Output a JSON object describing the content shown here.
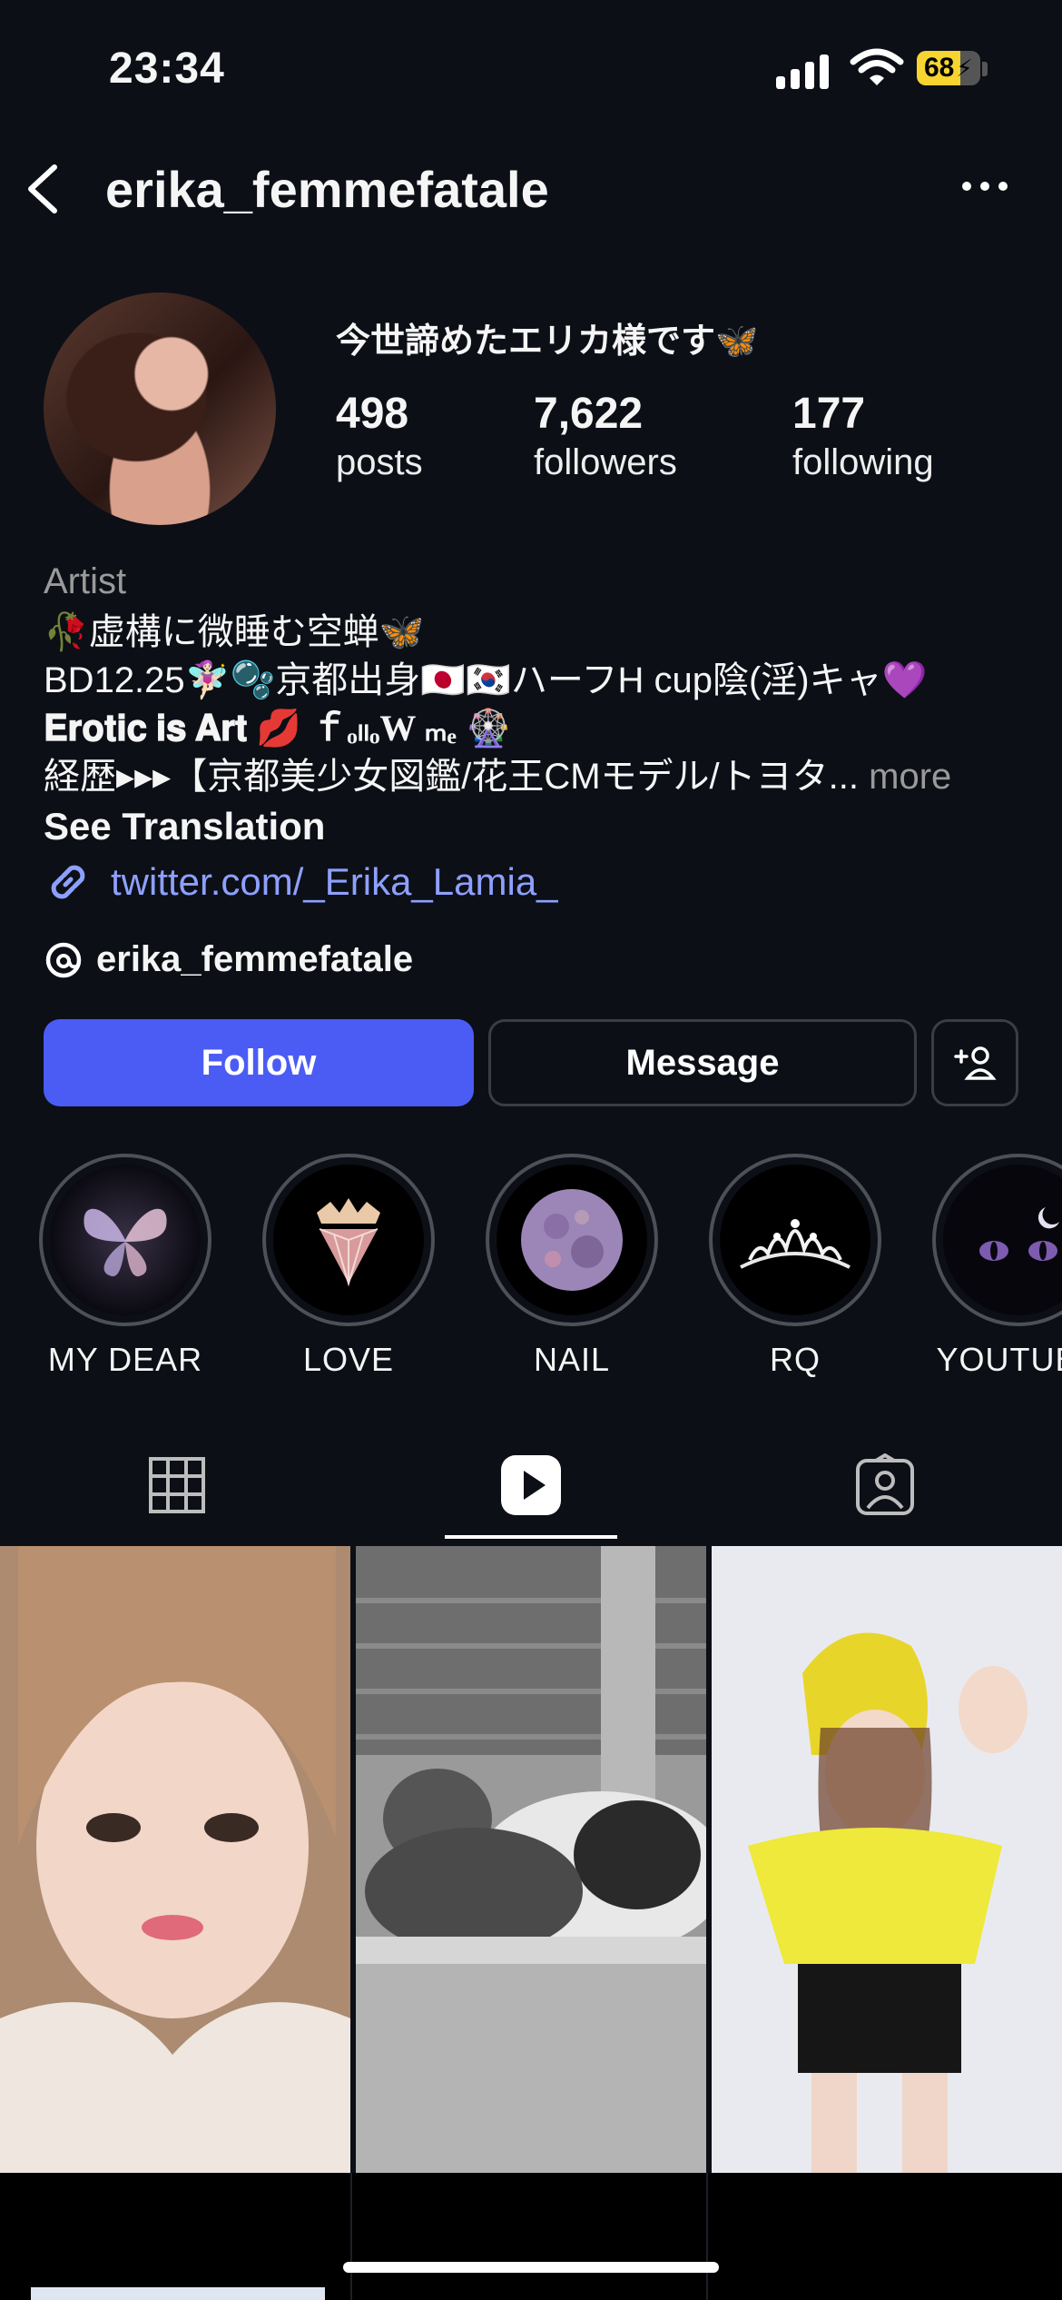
{
  "status_bar": {
    "time": "23:34",
    "battery": "68",
    "battery_percent": 68,
    "icons": [
      "cellular-signal-icon",
      "wifi-icon",
      "battery-charging-icon"
    ]
  },
  "header": {
    "username": "erika_femmefatale",
    "icons": [
      "back-chevron-icon",
      "more-options-icon"
    ]
  },
  "profile": {
    "display_name": "今世諦めたエリカ様です🦋",
    "stats": [
      {
        "value": "498",
        "label": "posts"
      },
      {
        "value": "7,622",
        "label": "followers"
      },
      {
        "value": "177",
        "label": "following"
      }
    ],
    "category": "Artist",
    "bio_lines": [
      "🥀虚構に微睡む空蝉🦋",
      "BD12.25🧚🏻‍♀️🫧京都出身🇯🇵🇰🇷ハーフH cup陰(淫)キャ💜",
      "𝐄𝐫𝐨𝐭𝐢𝐜 𝐢𝐬 𝐀𝐫𝐭 💋 ｆₒₗₗₒW ₘₑ 🎡",
      "経歴▸▸▸【京都美少女図鑑/花王CMモデル/トヨタ..."
    ],
    "bio_more": "more",
    "see_translation": "See Translation",
    "link": "twitter.com/_Erika_Lamia_",
    "threads_handle": "erika_femmefatale"
  },
  "actions": {
    "follow": "Follow",
    "message": "Message"
  },
  "highlights": [
    {
      "label": "MY DEAR",
      "icon": "butterfly-icon"
    },
    {
      "label": "LOVE",
      "icon": "diamond-crown-icon"
    },
    {
      "label": "NAIL",
      "icon": "moon-icon"
    },
    {
      "label": "RQ",
      "icon": "tiara-icon"
    },
    {
      "label": "YOUTUBE",
      "icon": "cat-eyes-icon"
    }
  ],
  "tabs": [
    {
      "name": "posts-grid",
      "icon": "grid-icon",
      "active": false
    },
    {
      "name": "reels",
      "icon": "reels-play-icon",
      "active": true
    },
    {
      "name": "tagged",
      "icon": "tagged-person-icon",
      "active": false
    }
  ],
  "colors": {
    "background": "#0c0f16",
    "accent": "#4b5cf5",
    "link": "#8ea0ff",
    "battery": "#f7d430"
  }
}
